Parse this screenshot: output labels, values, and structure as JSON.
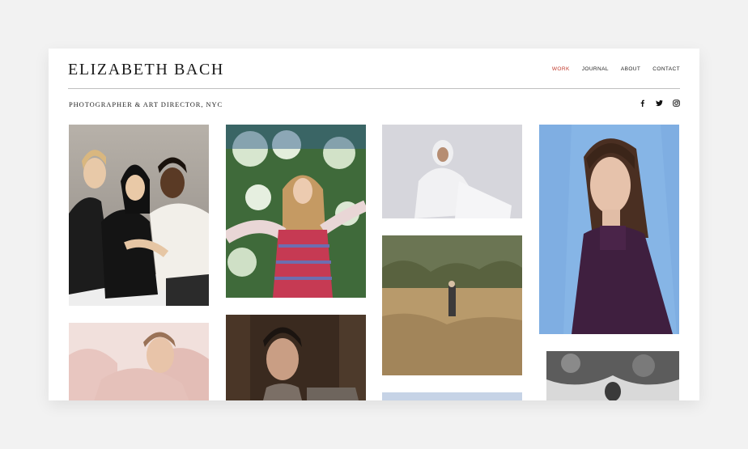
{
  "header": {
    "brand": "ELIZABETH BACH",
    "tagline": "PHOTOGRAPHER & ART DIRECTOR, NYC"
  },
  "nav": {
    "items": [
      {
        "label": "WORK",
        "active": true
      },
      {
        "label": "JOURNAL"
      },
      {
        "label": "ABOUT"
      },
      {
        "label": "CONTACT"
      }
    ]
  },
  "social": {
    "icons": [
      "facebook-icon",
      "twitter-icon",
      "instagram-icon"
    ]
  },
  "gallery": {
    "photos": [
      {
        "name": "three-models-group-portrait"
      },
      {
        "name": "girl-in-blossoms"
      },
      {
        "name": "woman-in-white-hijab"
      },
      {
        "name": "woman-in-purple-turtleneck"
      },
      {
        "name": "figure-in-tall-grass"
      },
      {
        "name": "woman-in-pink-feathers"
      },
      {
        "name": "man-portrait-dark"
      },
      {
        "name": "man-under-tree-bw"
      },
      {
        "name": "sky-partial"
      }
    ]
  },
  "colors": {
    "accent": "#c0392b",
    "background": "#f2f2f2",
    "page": "#ffffff"
  }
}
